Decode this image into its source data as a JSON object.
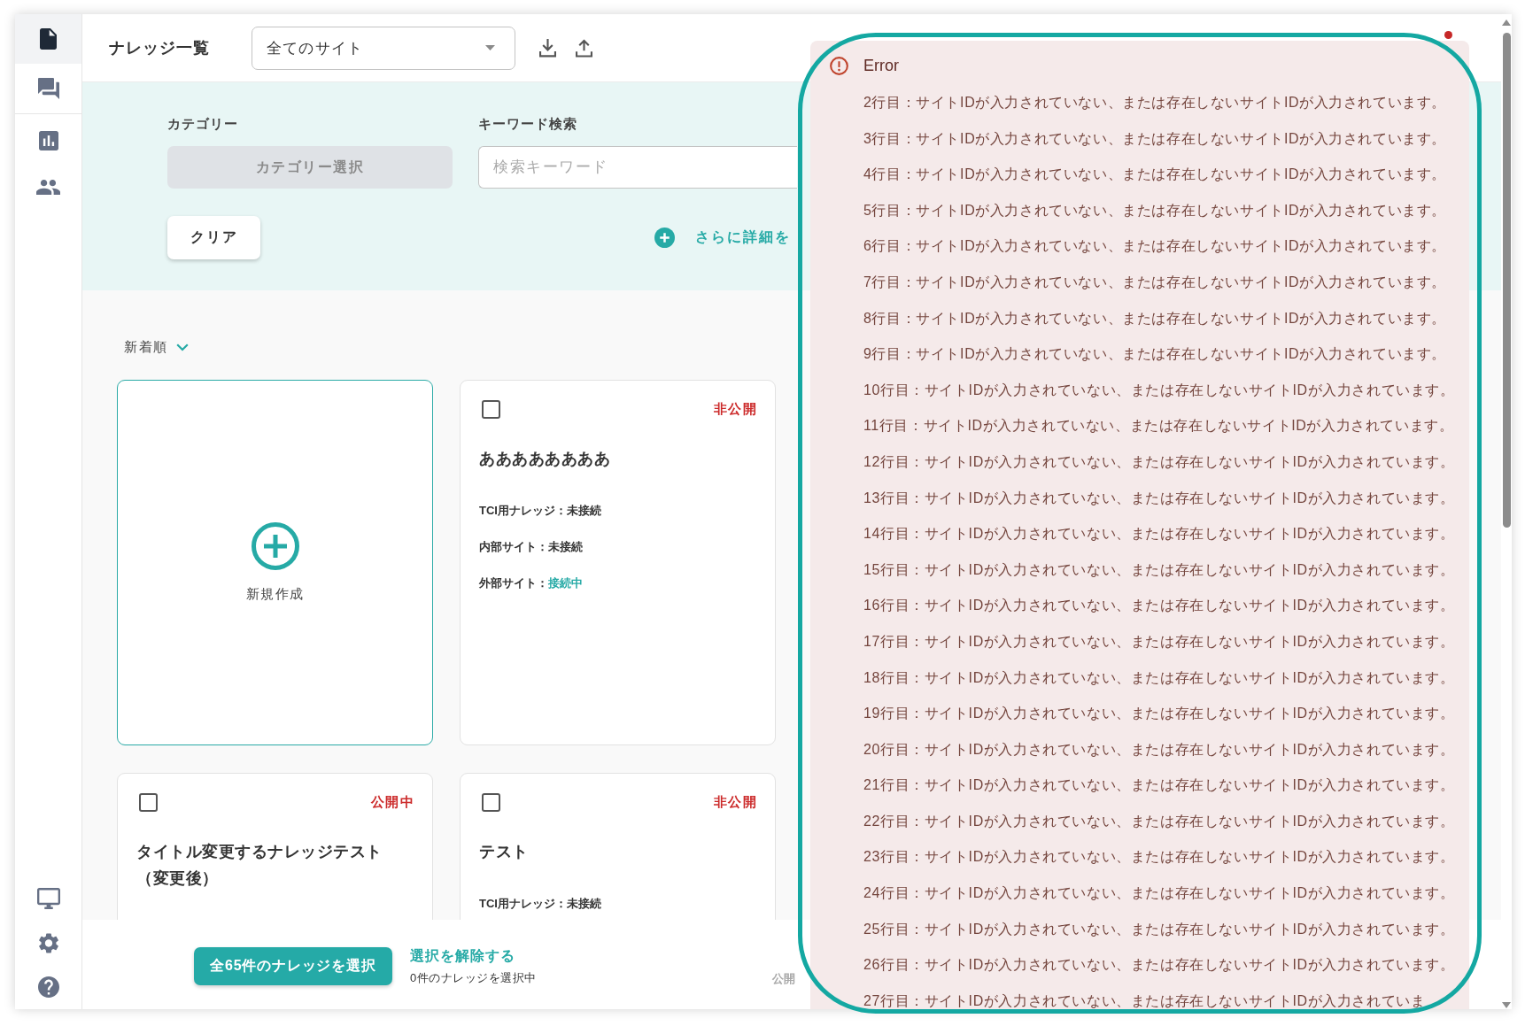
{
  "sidebar": {
    "items": [
      {
        "selected": true
      },
      {
        "selected": false
      },
      {
        "selected": false
      },
      {
        "selected": false
      }
    ]
  },
  "header": {
    "title": "ナレッジ一覧",
    "site_select": "全てのサイト",
    "has_notification": true
  },
  "filters": {
    "category": {
      "label": "カテゴリー",
      "button": "カテゴリー選択"
    },
    "keyword": {
      "label": "キーワード検索",
      "placeholder": "検索キーワード"
    },
    "clear_button": "クリア",
    "more_filters_link": "さらに詳細を"
  },
  "sort": {
    "label": "新着順"
  },
  "new_card": {
    "label": "新規作成"
  },
  "cards": [
    {
      "checked": false,
      "status": "非公開",
      "title": "ああああああああ",
      "info": [
        {
          "label": "TCI用ナレッジ：",
          "value": "未接続",
          "connected": false
        },
        {
          "label": "内部サイト：",
          "value": "未接続",
          "connected": false
        },
        {
          "label": "外部サイト：",
          "value": "接続中",
          "connected": true
        }
      ]
    },
    {
      "checked": false,
      "status": "公開中",
      "title": "タイトル変更するナレッジテスト（変更後）"
    },
    {
      "checked": false,
      "status": "非公開",
      "title": "テスト",
      "info": [
        {
          "label": "TCI用ナレッジ：",
          "value": "未接続",
          "connected": false
        }
      ]
    }
  ],
  "bottom_bar": {
    "select_all_button": "全65件のナレッジを選択",
    "deselect_link": "選択を解除する",
    "selection_count": "0件のナレッジを選択中",
    "faded_text": "公開"
  },
  "error_alert": {
    "title": "Error",
    "messages": [
      "2行目：サイトIDが入力されていない、または存在しないサイトIDが入力されています。",
      "3行目：サイトIDが入力されていない、または存在しないサイトIDが入力されています。",
      "4行目：サイトIDが入力されていない、または存在しないサイトIDが入力されています。",
      "5行目：サイトIDが入力されていない、または存在しないサイトIDが入力されています。",
      "6行目：サイトIDが入力されていない、または存在しないサイトIDが入力されています。",
      "7行目：サイトIDが入力されていない、または存在しないサイトIDが入力されています。",
      "8行目：サイトIDが入力されていない、または存在しないサイトIDが入力されています。",
      "9行目：サイトIDが入力されていない、または存在しないサイトIDが入力されています。",
      "10行目：サイトIDが入力されていない、または存在しないサイトIDが入力されています。",
      "11行目：サイトIDが入力されていない、または存在しないサイトIDが入力されています。",
      "12行目：サイトIDが入力されていない、または存在しないサイトIDが入力されています。",
      "13行目：サイトIDが入力されていない、または存在しないサイトIDが入力されています。",
      "14行目：サイトIDが入力されていない、または存在しないサイトIDが入力されています。",
      "15行目：サイトIDが入力されていない、または存在しないサイトIDが入力されています。",
      "16行目：サイトIDが入力されていない、または存在しないサイトIDが入力されています。",
      "17行目：サイトIDが入力されていない、または存在しないサイトIDが入力されています。",
      "18行目：サイトIDが入力されていない、または存在しないサイトIDが入力されています。",
      "19行目：サイトIDが入力されていない、または存在しないサイトIDが入力されています。",
      "20行目：サイトIDが入力されていない、または存在しないサイトIDが入力されています。",
      "21行目：サイトIDが入力されていない、または存在しないサイトIDが入力されています。",
      "22行目：サイトIDが入力されていない、または存在しないサイトIDが入力されています。",
      "23行目：サイトIDが入力されていない、または存在しないサイトIDが入力されています。",
      "24行目：サイトIDが入力されていない、または存在しないサイトIDが入力されています。",
      "25行目：サイトIDが入力されていない、または存在しないサイトIDが入力されています。",
      "26行目：サイトIDが入力されていない、または存在しないサイトIDが入力されています。",
      "27行目：サイトIDが入力されていない、または存在しないサイトIDが入力されていま"
    ]
  }
}
